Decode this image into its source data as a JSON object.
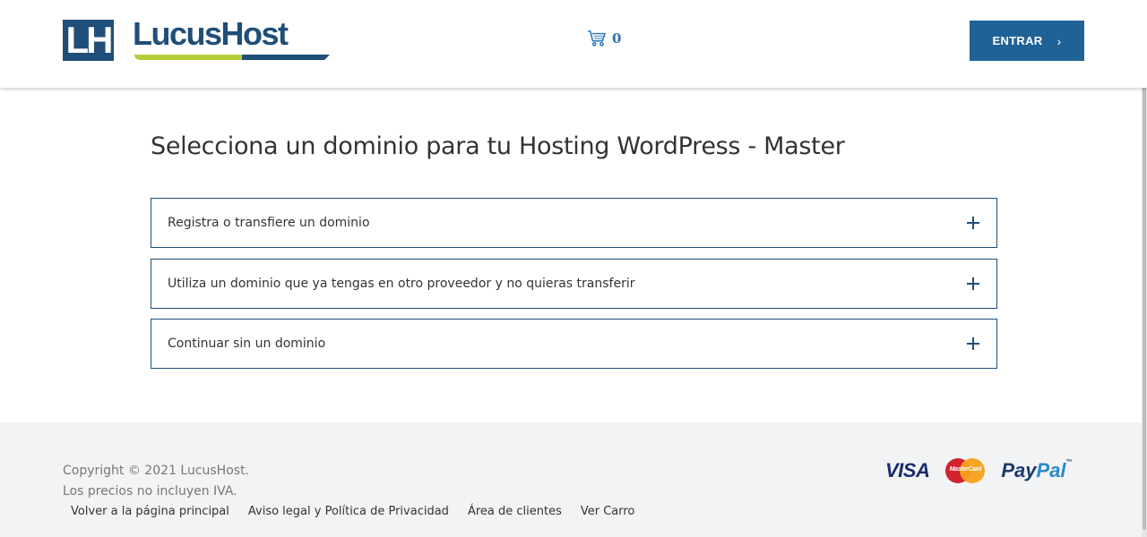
{
  "header": {
    "logo_mark": "LH",
    "logo_text": "LucusHost",
    "cart_count": "0",
    "enter_label": "ENTRAR",
    "enter_chevron": "›"
  },
  "main": {
    "title": "Selecciona un dominio para tu Hosting WordPress - Master",
    "options": [
      {
        "label": "Registra o transfiere un dominio"
      },
      {
        "label": "Utiliza un dominio que ya tengas en otro proveedor y no quieras transferir"
      },
      {
        "label": "Continuar sin un dominio"
      }
    ]
  },
  "footer": {
    "copyright": "Copyright © 2021 LucusHost.",
    "vat_note": "Los precios no incluyen IVA.",
    "links": [
      {
        "label": "Volver a la página principal"
      },
      {
        "label": "Aviso legal y Política de Privacidad"
      },
      {
        "label": "Área de clientes"
      },
      {
        "label": "Ver Carro"
      }
    ],
    "payments": {
      "visa": "VISA",
      "mastercard": "MasterCard",
      "paypal_a": "Pay",
      "paypal_b": "Pal",
      "paypal_tm": "™"
    }
  },
  "icons": {
    "cart": "shopping-cart-icon",
    "plus": "plus-icon",
    "chevron": "chevron-right-icon"
  },
  "colors": {
    "brand_blue": "#1f4e79",
    "button_blue": "#1f6296",
    "brand_green": "#b8cc3a",
    "cart_blue": "#2a73b5",
    "footer_bg": "#f2f3f5"
  }
}
